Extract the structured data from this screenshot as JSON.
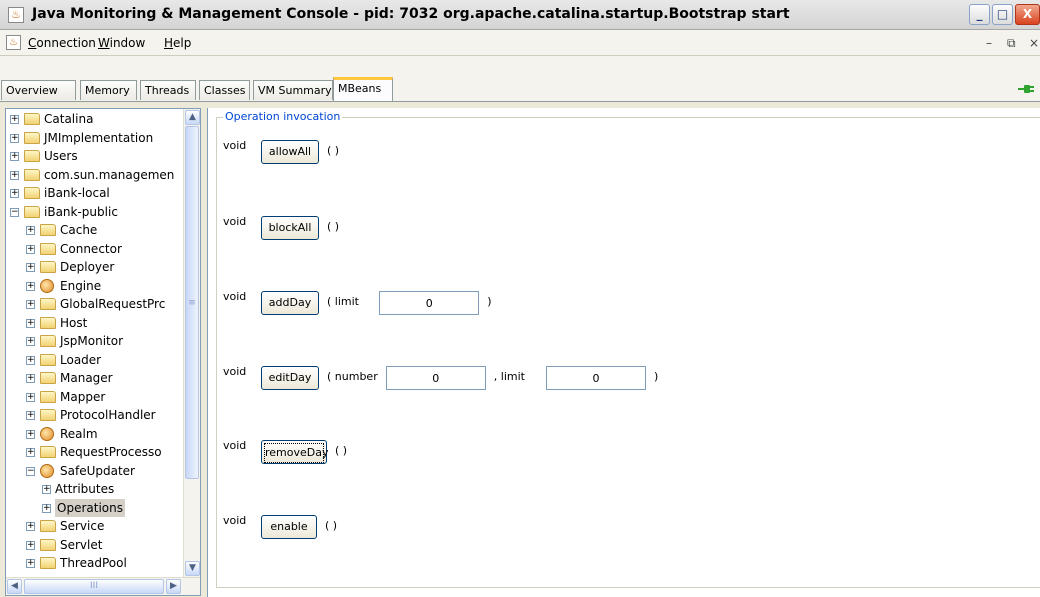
{
  "window": {
    "title": "Java Monitoring & Management Console - pid: 7032 org.apache.catalina.startup.Bootstrap start",
    "minimize": "_",
    "maximize": "□",
    "close": "X"
  },
  "menu": {
    "items": [
      "Connection",
      "Window",
      "Help"
    ],
    "mnemonics": [
      "C",
      "W",
      "H"
    ],
    "mdi_minimize": "–",
    "mdi_restore": "⧉",
    "mdi_close": "×"
  },
  "tabs": [
    "Overview",
    "Memory",
    "Threads",
    "Classes",
    "VM Summary",
    "MBeans"
  ],
  "active_tab": "MBeans",
  "tree": [
    {
      "label": "Catalina",
      "level": 0,
      "expand": "+",
      "icon": "folder-icon"
    },
    {
      "label": "JMImplementation",
      "level": 0,
      "expand": "+",
      "icon": "folder-icon"
    },
    {
      "label": "Users",
      "level": 0,
      "expand": "+",
      "icon": "folder-icon"
    },
    {
      "label": "com.sun.managemen",
      "level": 0,
      "expand": "+",
      "icon": "folder-icon"
    },
    {
      "label": "iBank-local",
      "level": 0,
      "expand": "+",
      "icon": "folder-icon"
    },
    {
      "label": "iBank-public",
      "level": 0,
      "expand": "−",
      "icon": "folder-icon"
    },
    {
      "label": "Cache",
      "level": 1,
      "expand": "+",
      "icon": "folder-icon"
    },
    {
      "label": "Connector",
      "level": 1,
      "expand": "+",
      "icon": "folder-icon"
    },
    {
      "label": "Deployer",
      "level": 1,
      "expand": "+",
      "icon": "folder-icon"
    },
    {
      "label": "Engine",
      "level": 1,
      "expand": "+",
      "icon": "bean-icon"
    },
    {
      "label": "GlobalRequestPrc",
      "level": 1,
      "expand": "+",
      "icon": "folder-icon"
    },
    {
      "label": "Host",
      "level": 1,
      "expand": "+",
      "icon": "folder-icon"
    },
    {
      "label": "JspMonitor",
      "level": 1,
      "expand": "+",
      "icon": "folder-icon"
    },
    {
      "label": "Loader",
      "level": 1,
      "expand": "+",
      "icon": "folder-icon"
    },
    {
      "label": "Manager",
      "level": 1,
      "expand": "+",
      "icon": "folder-icon"
    },
    {
      "label": "Mapper",
      "level": 1,
      "expand": "+",
      "icon": "folder-icon"
    },
    {
      "label": "ProtocolHandler",
      "level": 1,
      "expand": "+",
      "icon": "folder-icon"
    },
    {
      "label": "Realm",
      "level": 1,
      "expand": "+",
      "icon": "bean-icon"
    },
    {
      "label": "RequestProcesso",
      "level": 1,
      "expand": "+",
      "icon": "folder-icon"
    },
    {
      "label": "SafeUpdater",
      "level": 1,
      "expand": "−",
      "icon": "bean-icon"
    },
    {
      "label": "Attributes",
      "level": 2,
      "expand": "+",
      "icon": ""
    },
    {
      "label": "Operations",
      "level": 2,
      "expand": "+",
      "icon": "",
      "selected": true
    },
    {
      "label": "Service",
      "level": 1,
      "expand": "+",
      "icon": "folder-icon"
    },
    {
      "label": "Servlet",
      "level": 1,
      "expand": "+",
      "icon": "folder-icon"
    },
    {
      "label": "ThreadPool",
      "level": 1,
      "expand": "+",
      "icon": "folder-icon"
    }
  ],
  "scroll": {
    "up": "▲",
    "down": "▼",
    "left": "◀",
    "right": "▶",
    "grip": "≡",
    "hgrip": "III"
  },
  "operations_panel": {
    "legend": "Operation invocation",
    "operations": [
      {
        "return": "void",
        "name": "allowAll",
        "suffix": "( )",
        "params": []
      },
      {
        "return": "void",
        "name": "blockAll",
        "suffix": "( )",
        "params": []
      },
      {
        "return": "void",
        "name": "addDay",
        "suffix": ")",
        "params": [
          {
            "prefix": "( limit",
            "value": "0"
          }
        ]
      },
      {
        "return": "void",
        "name": "editDay",
        "suffix": ")",
        "params": [
          {
            "prefix": "( number",
            "value": "0"
          },
          {
            "prefix": ", limit",
            "value": "0"
          }
        ]
      },
      {
        "return": "void",
        "name": "removeDay",
        "suffix": "( )",
        "params": [],
        "focused": true
      },
      {
        "return": "void",
        "name": "enable",
        "suffix": "( )",
        "params": []
      }
    ]
  },
  "colors": {
    "legend": "#0046d5",
    "active_tab_accent": "#ffc83c",
    "connection_indicator": "#2fa52f"
  },
  "connection_icon": "plug-icon"
}
